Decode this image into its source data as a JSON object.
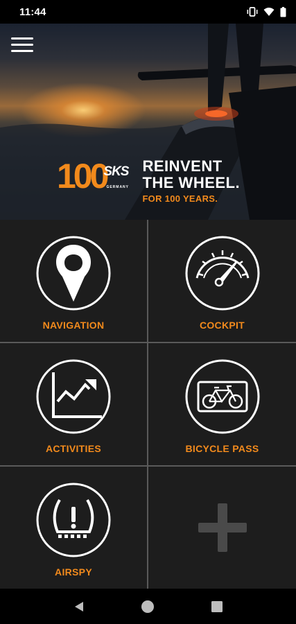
{
  "status_bar": {
    "time": "11:44"
  },
  "hero": {
    "logo_number": "100",
    "logo_brand": "SKS",
    "logo_brand_sub": "GERMANY",
    "tagline_line1": "REINVENT",
    "tagline_line2": "THE WHEEL.",
    "tagline_line3": "FOR 100 YEARS."
  },
  "tiles": [
    {
      "label": "NAVIGATION",
      "icon": "map-pin-icon"
    },
    {
      "label": "COCKPIT",
      "icon": "speedometer-icon"
    },
    {
      "label": "ACTIVITIES",
      "icon": "trend-chart-icon"
    },
    {
      "label": "BICYCLE PASS",
      "icon": "bicycle-icon"
    },
    {
      "label": "AIRSPY",
      "icon": "tire-pressure-icon"
    },
    {
      "label": "",
      "icon": "plus-icon"
    }
  ],
  "colors": {
    "accent": "#f28a1c",
    "tile_bg": "#1d1d1d",
    "divider": "#5a5a5a"
  }
}
